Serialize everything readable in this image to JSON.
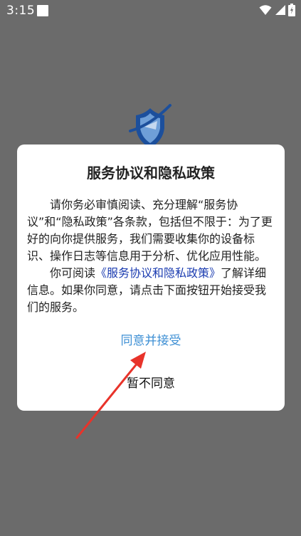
{
  "status_bar": {
    "time": "3:15",
    "icons": [
      "notification-icon",
      "wifi-icon",
      "signal-icon",
      "battery-icon"
    ]
  },
  "app": {
    "logo_icon": "shield-logo-icon",
    "logo_color": "#1c4f9c"
  },
  "dialog": {
    "title": "服务协议和隐私政策",
    "paragraph1": "请你务必审慎阅读、充分理解“服务协议”和“隐私政策”各条款，包括但不限于：为了更好的向你提供服务，我们需要收集你的设备标识、操作日志等信息用于分析、优化应用性能。",
    "paragraph2_prefix": "你可阅读",
    "paragraph2_link": "《服务协议和隐私政策》",
    "paragraph2_suffix": "了解详细信息。如果你同意，请点击下面按钮开始接受我们的服务。",
    "accept_label": "同意并接受",
    "decline_label": "暂不同意"
  },
  "colors": {
    "overlay": "#6b6b6b",
    "accept": "#3d8fd4",
    "link": "#1a3bb0",
    "arrow": "#e8332a"
  }
}
